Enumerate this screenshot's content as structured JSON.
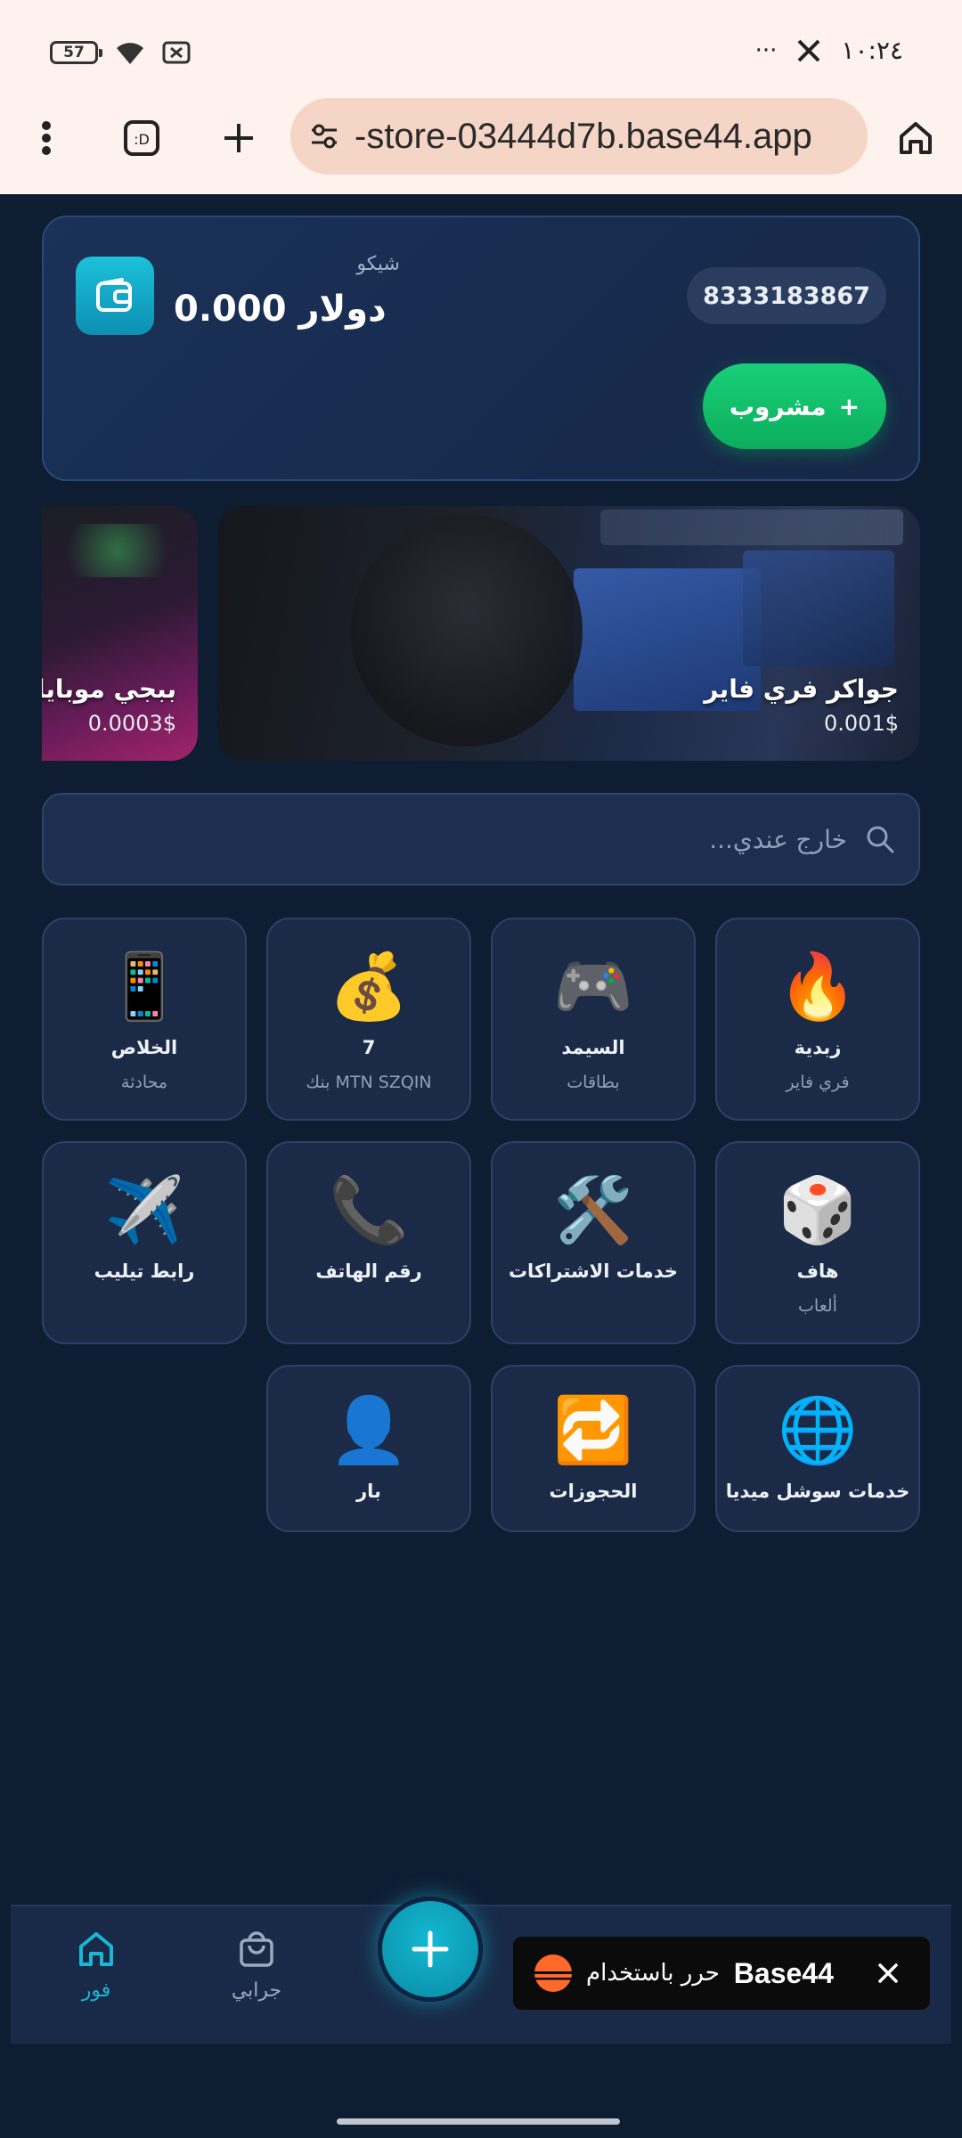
{
  "status_bar": {
    "battery": "57",
    "time": "١٠:٢٤",
    "more": "···"
  },
  "browser": {
    "url": "-store-03444d7b.base44.app"
  },
  "wallet": {
    "name": "شيكو",
    "balance": "دولار 0.000",
    "account_number": "8333183867",
    "topup_label": "مشروب",
    "topup_plus": "+"
  },
  "banners": [
    {
      "title": "جواكر فري فاير",
      "price": "0.001$"
    },
    {
      "title": "ببجي موبايل",
      "price": "0.0003$"
    }
  ],
  "search": {
    "placeholder": "خارج عندي..."
  },
  "categories": [
    {
      "emoji": "🔥",
      "title": "زبدية",
      "subtitle": "فري فاير"
    },
    {
      "emoji": "🎮",
      "title": "السيمد",
      "subtitle": "بطاقات"
    },
    {
      "emoji": "💰",
      "title": "7",
      "subtitle": "بنك MTN SZQIN"
    },
    {
      "emoji": "📱",
      "title": "الخلاص",
      "subtitle": "محادثة"
    },
    {
      "emoji": "🎲",
      "title": "هاف",
      "subtitle": "ألعاب"
    },
    {
      "emoji": "🛠️",
      "title": "خدمات الاشتراكات",
      "subtitle": ""
    },
    {
      "emoji": "📞",
      "title": "رقم الهاتف",
      "subtitle": ""
    },
    {
      "emoji": "✈️",
      "title": "رابط تيليب",
      "subtitle": ""
    },
    {
      "emoji": "🌐",
      "title": "خدمات سوشل ميديا",
      "subtitle": ""
    },
    {
      "emoji": "🔁",
      "title": "الحجوزات",
      "subtitle": ""
    },
    {
      "emoji": "👤",
      "title": "بار",
      "subtitle": ""
    }
  ],
  "nav": {
    "home": "فور",
    "orders": "جرابي",
    "fab": "+"
  },
  "toast": {
    "text": "حرر باستخدام",
    "brand": "Base44"
  },
  "colors": {
    "accent": "#14b8d1",
    "topup": "#10c06a",
    "background": "#0f1d33"
  }
}
